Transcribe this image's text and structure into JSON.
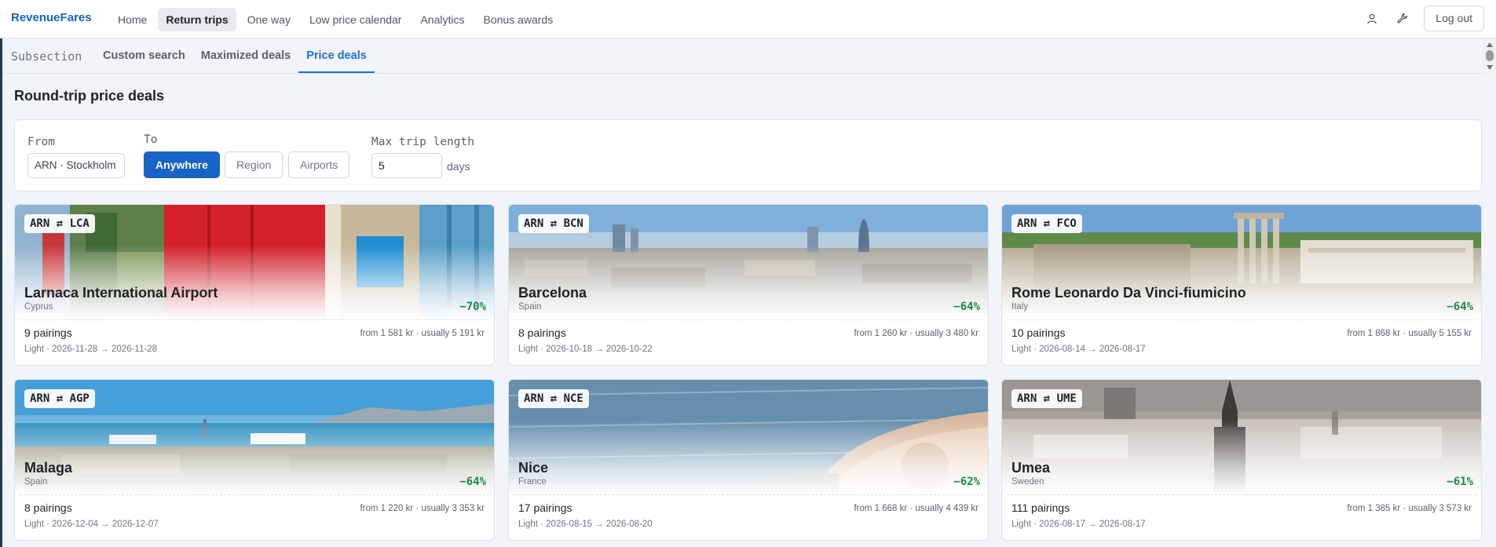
{
  "app": {
    "brand": "RevenueFares",
    "nav": [
      "Home",
      "Return trips",
      "One way",
      "Low price calendar",
      "Analytics",
      "Bonus awards"
    ],
    "nav_active": "Return trips",
    "logout_label": "Log out",
    "icons": [
      "user-icon",
      "wrench-icon"
    ]
  },
  "subnav": {
    "label": "Subsection",
    "tabs": [
      "Custom search",
      "Maximized deals",
      "Price deals"
    ],
    "active": "Price deals"
  },
  "page": {
    "title": "Round-trip price deals"
  },
  "filters": {
    "from_label": "From",
    "from_value": "ARN · Stockholm",
    "to_label": "To",
    "to_options": [
      "Anywhere",
      "Region",
      "Airports"
    ],
    "to_selected": "Anywhere",
    "max_label": "Max trip length",
    "max_value": "5",
    "max_unit": "days"
  },
  "deals": [
    {
      "route": "ARN ⇄ LCA",
      "name": "Larnaca International Airport",
      "country": "Cyprus",
      "discount": "−70%",
      "pairings": "9 pairings",
      "price": "from 1 581 kr · usually 5 191 kr",
      "dates": "Light · 2026-11-28 → 2026-11-28"
    },
    {
      "route": "ARN ⇄ BCN",
      "name": "Barcelona",
      "country": "Spain",
      "discount": "−64%",
      "pairings": "8 pairings",
      "price": "from 1 260 kr · usually 3 480 kr",
      "dates": "Light · 2026-10-18 → 2026-10-22"
    },
    {
      "route": "ARN ⇄ FCO",
      "name": "Rome Leonardo Da Vinci-fiumicino",
      "country": "Italy",
      "discount": "−64%",
      "pairings": "10 pairings",
      "price": "from 1 868 kr · usually 5 155 kr",
      "dates": "Light · 2026-08-14 → 2026-08-17"
    },
    {
      "route": "ARN ⇄ AGP",
      "name": "Malaga",
      "country": "Spain",
      "discount": "−64%",
      "pairings": "8 pairings",
      "price": "from 1 220 kr · usually 3 353 kr",
      "dates": "Light · 2026-12-04 → 2026-12-07"
    },
    {
      "route": "ARN ⇄ NCE",
      "name": "Nice",
      "country": "France",
      "discount": "−62%",
      "pairings": "17 pairings",
      "price": "from 1 668 kr · usually 4 439 kr",
      "dates": "Light · 2026-08-15 → 2026-08-20"
    },
    {
      "route": "ARN ⇄ UME",
      "name": "Umea",
      "country": "Sweden",
      "discount": "−61%",
      "pairings": "111 pairings",
      "price": "from 1 385 kr · usually 3 573 kr",
      "dates": "Light · 2026-08-17 → 2026-08-17"
    }
  ]
}
